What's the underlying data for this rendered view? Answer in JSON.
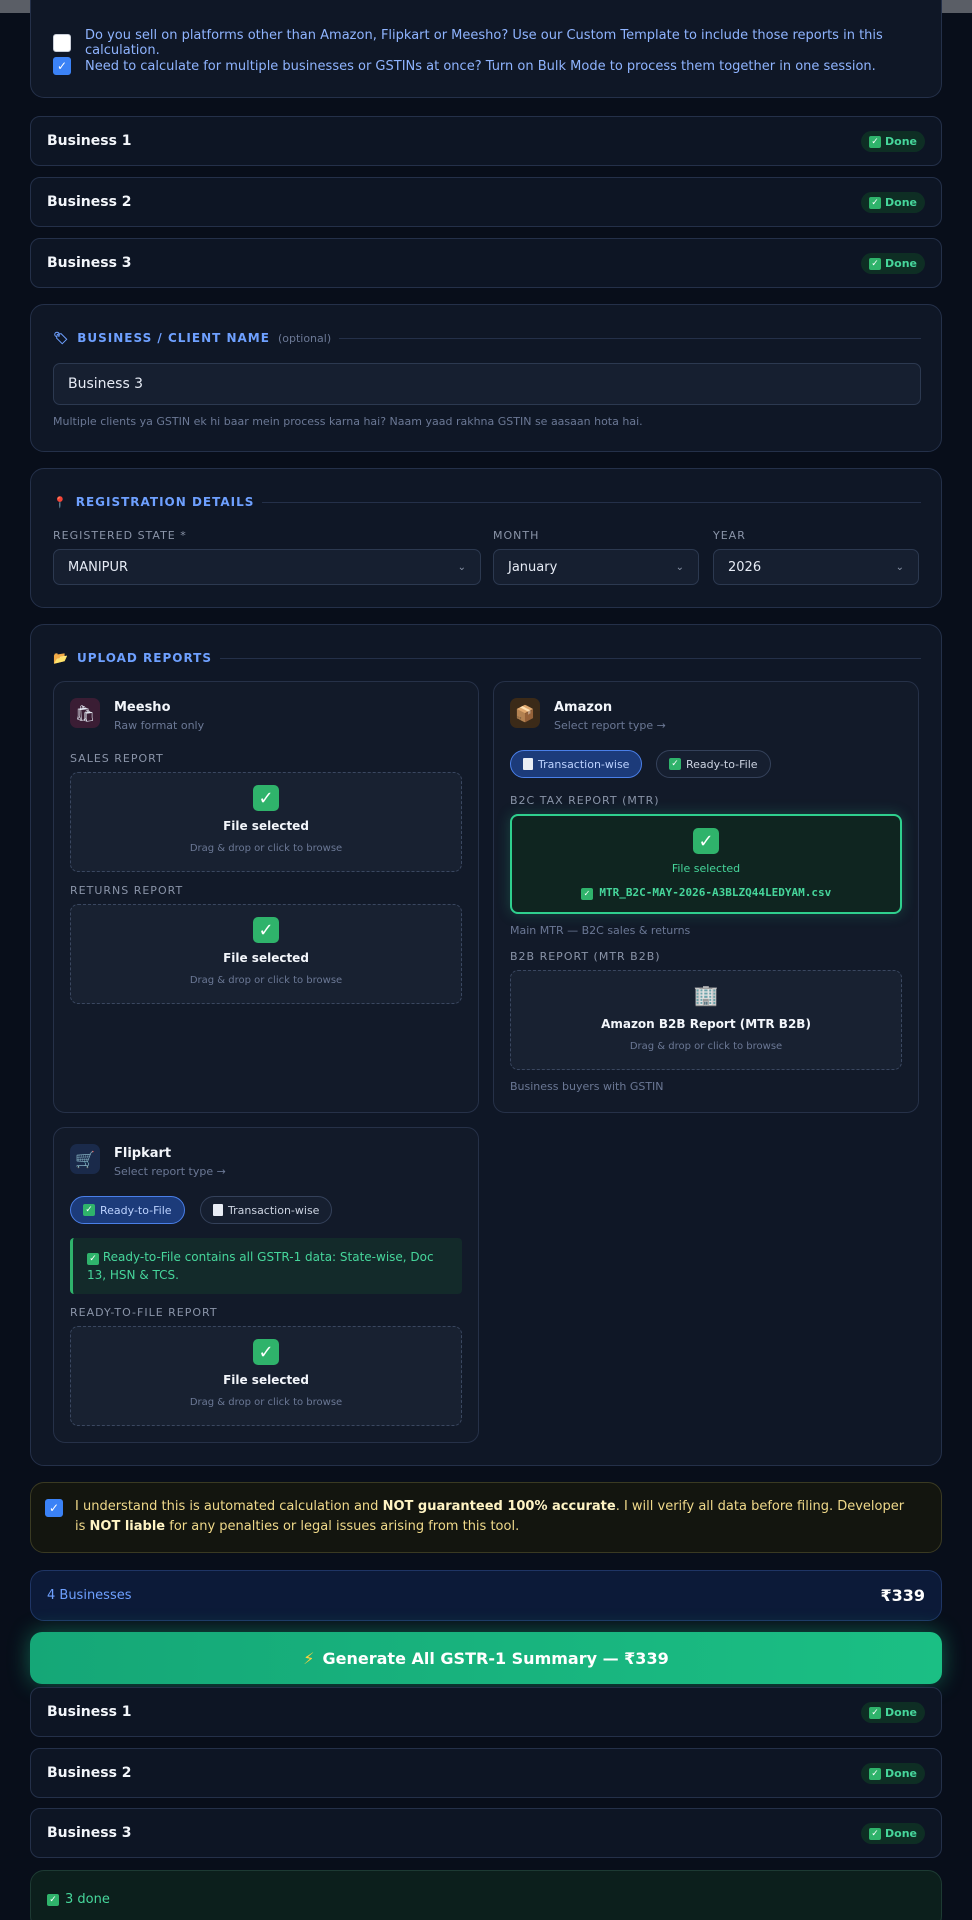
{
  "options": {
    "custom_template": {
      "checked": false,
      "text": "Do you sell on platforms other than Amazon, Flipkart or Meesho? Use our Custom Template to include those reports in this calculation."
    },
    "bulk_mode": {
      "checked": true,
      "text": "Need to calculate for multiple businesses or GSTINs at once? Turn on Bulk Mode to process them together in one session."
    }
  },
  "businesses_top": [
    {
      "name": "Business 1",
      "status": "Done"
    },
    {
      "name": "Business 2",
      "status": "Done"
    },
    {
      "name": "Business 3",
      "status": "Done"
    }
  ],
  "client": {
    "icon": "tag-icon",
    "title": "BUSINESS / CLIENT NAME",
    "optional": "(optional)",
    "value": "Business 3",
    "hint": "Multiple clients ya GSTIN ek hi baar mein process karna hai? Naam yaad rakhna GSTIN se aasaan hota hai."
  },
  "registration": {
    "icon": "pin-icon",
    "title": "REGISTRATION DETAILS",
    "state_label": "REGISTERED STATE *",
    "state_value": "MANIPUR",
    "month_label": "MONTH",
    "month_value": "January",
    "year_label": "YEAR",
    "year_value": "2026"
  },
  "upload": {
    "icon": "folder-icon",
    "title": "UPLOAD REPORTS",
    "meesho": {
      "name": "Meesho",
      "sub": "Raw format only",
      "sales_label": "SALES REPORT",
      "sales_status": "File selected",
      "sales_hint": "Drag & drop or click to browse",
      "returns_label": "RETURNS REPORT",
      "returns_status": "File selected",
      "returns_hint": "Drag & drop or click to browse"
    },
    "amazon": {
      "name": "Amazon",
      "sub": "Select report type →",
      "pill_transaction": "Transaction-wise",
      "pill_ready": "Ready-to-File",
      "b2c_label": "B2C TAX REPORT (MTR)",
      "b2c_status": "File selected",
      "b2c_file": "MTR_B2C-MAY-2026-A3BLZQ44LEDYAM.csv",
      "b2c_caption": "Main MTR — B2C sales & returns",
      "b2b_label": "B2B REPORT (MTR B2B)",
      "b2b_title": "Amazon B2B Report (MTR B2B)",
      "b2b_hint": "Drag & drop or click to browse",
      "b2b_caption": "Business buyers with GSTIN"
    },
    "flipkart": {
      "name": "Flipkart",
      "sub": "Select report type →",
      "pill_ready": "Ready-to-File",
      "pill_transaction": "Transaction-wise",
      "note": "Ready-to-File contains all GSTR-1 data: State-wise, Doc 13, HSN & TCS.",
      "rtf_label": "READY-TO-FILE REPORT",
      "rtf_status": "File selected",
      "rtf_hint": "Drag & drop or click to browse"
    }
  },
  "disclaimer": {
    "checked": true,
    "part1": "I understand this is automated calculation and ",
    "bold1": "NOT guaranteed 100% accurate",
    "part2": ". I will verify all data before filing. Developer is ",
    "bold2": "NOT liable",
    "part3": " for any penalties or legal issues arising from this tool."
  },
  "summary": {
    "count_label": "4 Businesses",
    "price": "₹339"
  },
  "generate_label": "Generate All GSTR-1 Summary — ₹339",
  "businesses_bottom": [
    {
      "name": "Business 1",
      "status": "Done"
    },
    {
      "name": "Business 2",
      "status": "Done"
    },
    {
      "name": "Business 3",
      "status": "Done"
    }
  ],
  "done_text": "3 done",
  "colors": {
    "accent": "#6ea0ff",
    "success": "#2fd08e",
    "cta": "#1bbf84",
    "background": "#080e1a"
  }
}
